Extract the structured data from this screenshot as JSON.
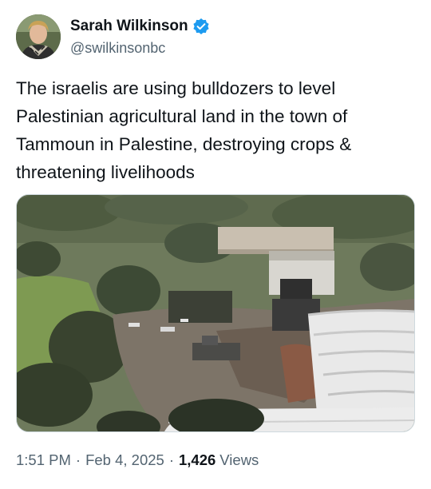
{
  "author": {
    "display_name": "Sarah Wilkinson",
    "handle": "@swilkinsonbc",
    "verified": true
  },
  "tweet": {
    "text": "The israelis are using bulldozers to level\nPalestinian agricultural land in the town of\nTammoun in Palestine, destroying crops &\nthreatening livelihoods"
  },
  "meta": {
    "time": "1:51 PM",
    "separator": "·",
    "date": "Feb 4, 2025",
    "views_count": "1,426",
    "views_label": "Views"
  },
  "colors": {
    "text_primary": "#0f1419",
    "text_secondary": "#536471",
    "verified_badge": "#1d9bf0"
  }
}
